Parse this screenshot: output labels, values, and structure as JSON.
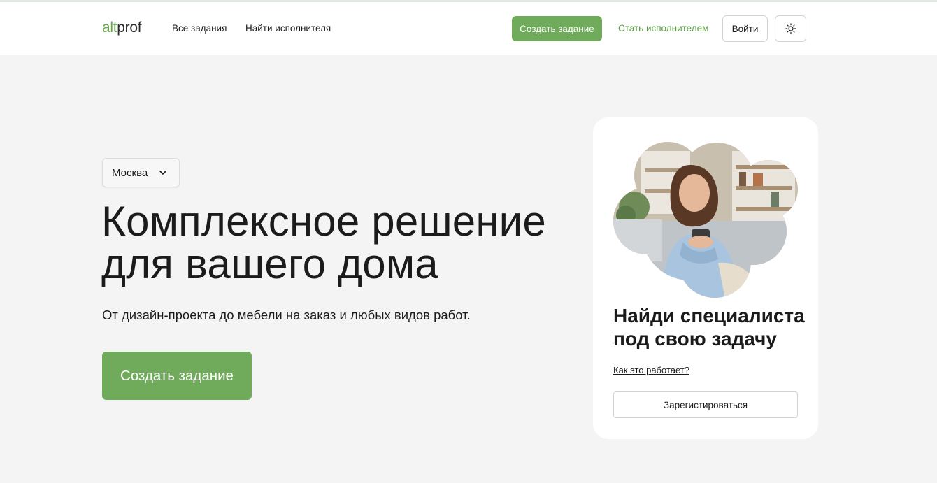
{
  "header": {
    "logo_prefix": "alt",
    "logo_suffix": "prof",
    "nav": [
      "Все задания",
      "Найти исполнителя"
    ],
    "create_label": "Создать задание",
    "become_label": "Стать исполнителем",
    "login_label": "Войти",
    "theme_icon": "sun-icon"
  },
  "hero": {
    "city": "Москва",
    "title_line1": "Комплексное решение",
    "title_line2": "для вашего дома",
    "subtitle": "От дизайн-проекта до мебели на заказ и любых видов работ.",
    "cta_label": "Создать задание"
  },
  "card": {
    "title_line1": "Найди специалиста",
    "title_line2": "под свою задачу",
    "how_link": "Как это работает?",
    "register_label": "Зарегистироваться"
  },
  "colors": {
    "accent": "#6fab5b",
    "background": "#f4f4f4",
    "card": "#ffffff",
    "text": "#1b1b1b"
  }
}
